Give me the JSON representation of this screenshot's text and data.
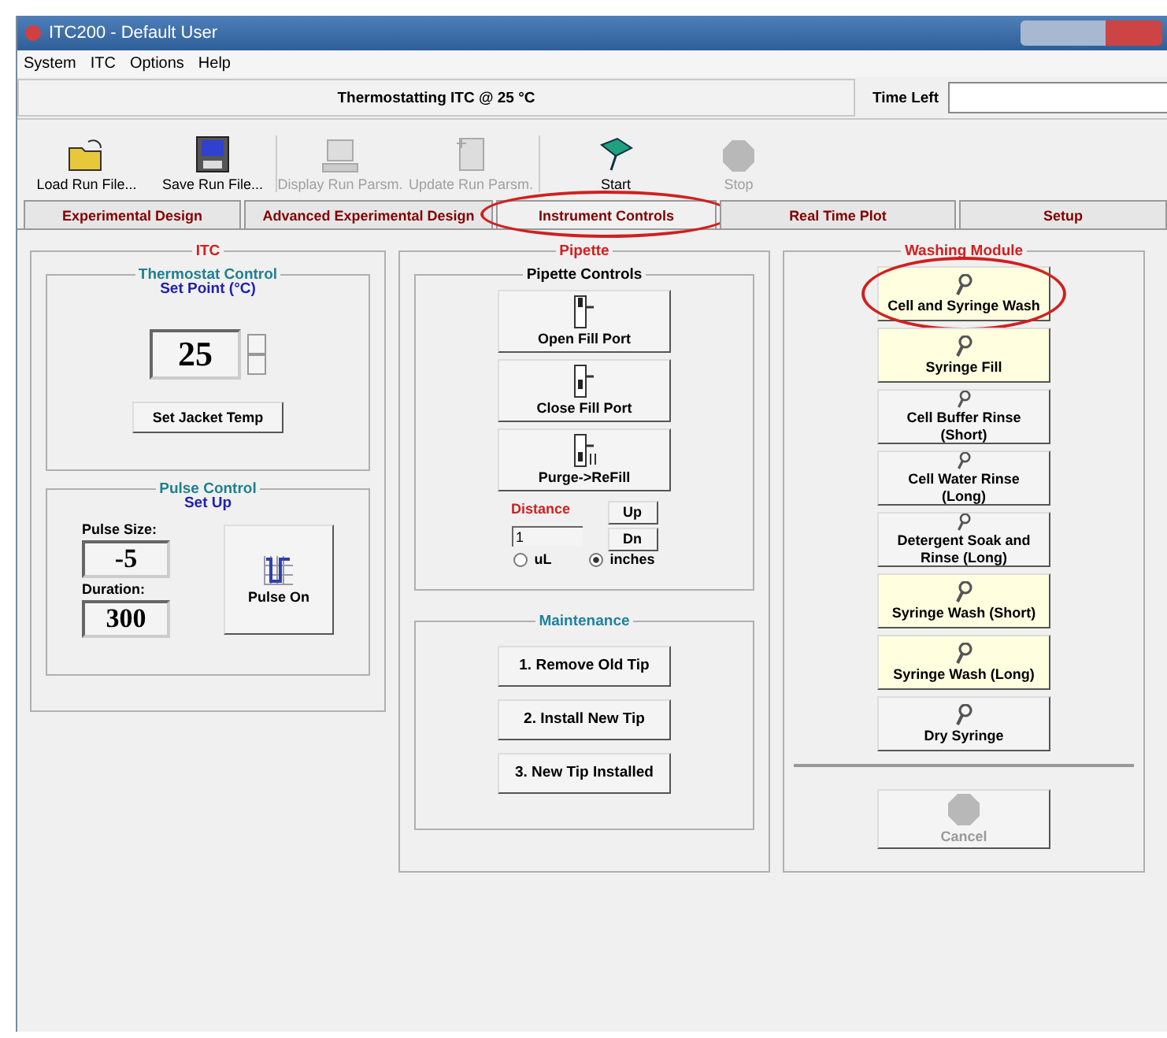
{
  "window": {
    "title": "ITC200 - Default User"
  },
  "menu": [
    "System",
    "ITC",
    "Options",
    "Help"
  ],
  "status": {
    "message": "Thermostatting ITC @ 25 °C",
    "time_left_label": "Time Left"
  },
  "toolbar": [
    {
      "label": "Load Run File...",
      "kind": "folder",
      "disabled": false
    },
    {
      "label": "Save Run File...",
      "kind": "floppy",
      "disabled": false
    },
    {
      "label": "Display Run Parsm.",
      "kind": "computer",
      "disabled": true
    },
    {
      "label": "Update Run Parsm.",
      "kind": "document",
      "disabled": true
    },
    {
      "label": "Start",
      "kind": "flag",
      "disabled": false
    },
    {
      "label": "Stop",
      "kind": "stop",
      "disabled": true
    }
  ],
  "tabs": [
    {
      "label": "Experimental Design",
      "selected": false,
      "circled": false
    },
    {
      "label": "Advanced Experimental Design",
      "selected": false,
      "circled": false
    },
    {
      "label": "Instrument Controls",
      "selected": true,
      "circled": true
    },
    {
      "label": "Real Time Plot",
      "selected": false,
      "circled": false
    },
    {
      "label": "Setup",
      "selected": false,
      "circled": false
    }
  ],
  "itc": {
    "title": "ITC",
    "thermostat": {
      "title": "Thermostat Control",
      "subtitle": "Set Point (°C)",
      "value": "25",
      "button": "Set Jacket Temp"
    },
    "pulse": {
      "title": "Pulse Control",
      "subtitle": "Set Up",
      "size_label": "Pulse Size:",
      "size_value": "-5",
      "duration_label": "Duration:",
      "duration_value": "300",
      "button": "Pulse On"
    }
  },
  "pipette": {
    "title": "Pipette",
    "controls_title": "Pipette Controls",
    "buttons": [
      {
        "label": "Open Fill Port",
        "kind": "open"
      },
      {
        "label": "Close Fill Port",
        "kind": "close"
      },
      {
        "label": "Purge->ReFill",
        "kind": "purge"
      }
    ],
    "distance_label": "Distance",
    "distance_value": "1",
    "up": "Up",
    "dn": "Dn",
    "units": [
      {
        "label": "uL",
        "selected": false
      },
      {
        "label": "inches",
        "selected": true
      }
    ]
  },
  "maintenance": {
    "title": "Maintenance",
    "buttons": [
      "1. Remove Old Tip",
      "2. Install New Tip",
      "3. New Tip Installed"
    ]
  },
  "washing": {
    "title": "Washing Module",
    "buttons": [
      {
        "label": "Cell and Syringe Wash",
        "tinted": true,
        "circled": true
      },
      {
        "label": "Syringe Fill",
        "tinted": true,
        "circled": false
      },
      {
        "label": "Cell Buffer Rinse\n(Short)",
        "tinted": false,
        "circled": false
      },
      {
        "label": "Cell Water Rinse\n(Long)",
        "tinted": false,
        "circled": false
      },
      {
        "label": "Detergent Soak and\nRinse (Long)",
        "tinted": false,
        "circled": false
      },
      {
        "label": "Syringe Wash (Short)",
        "tinted": true,
        "circled": false
      },
      {
        "label": "Syringe Wash (Long)",
        "tinted": true,
        "circled": false
      },
      {
        "label": "Dry Syringe",
        "tinted": false,
        "circled": false
      }
    ],
    "cancel": {
      "label": "Cancel",
      "disabled": true
    }
  }
}
